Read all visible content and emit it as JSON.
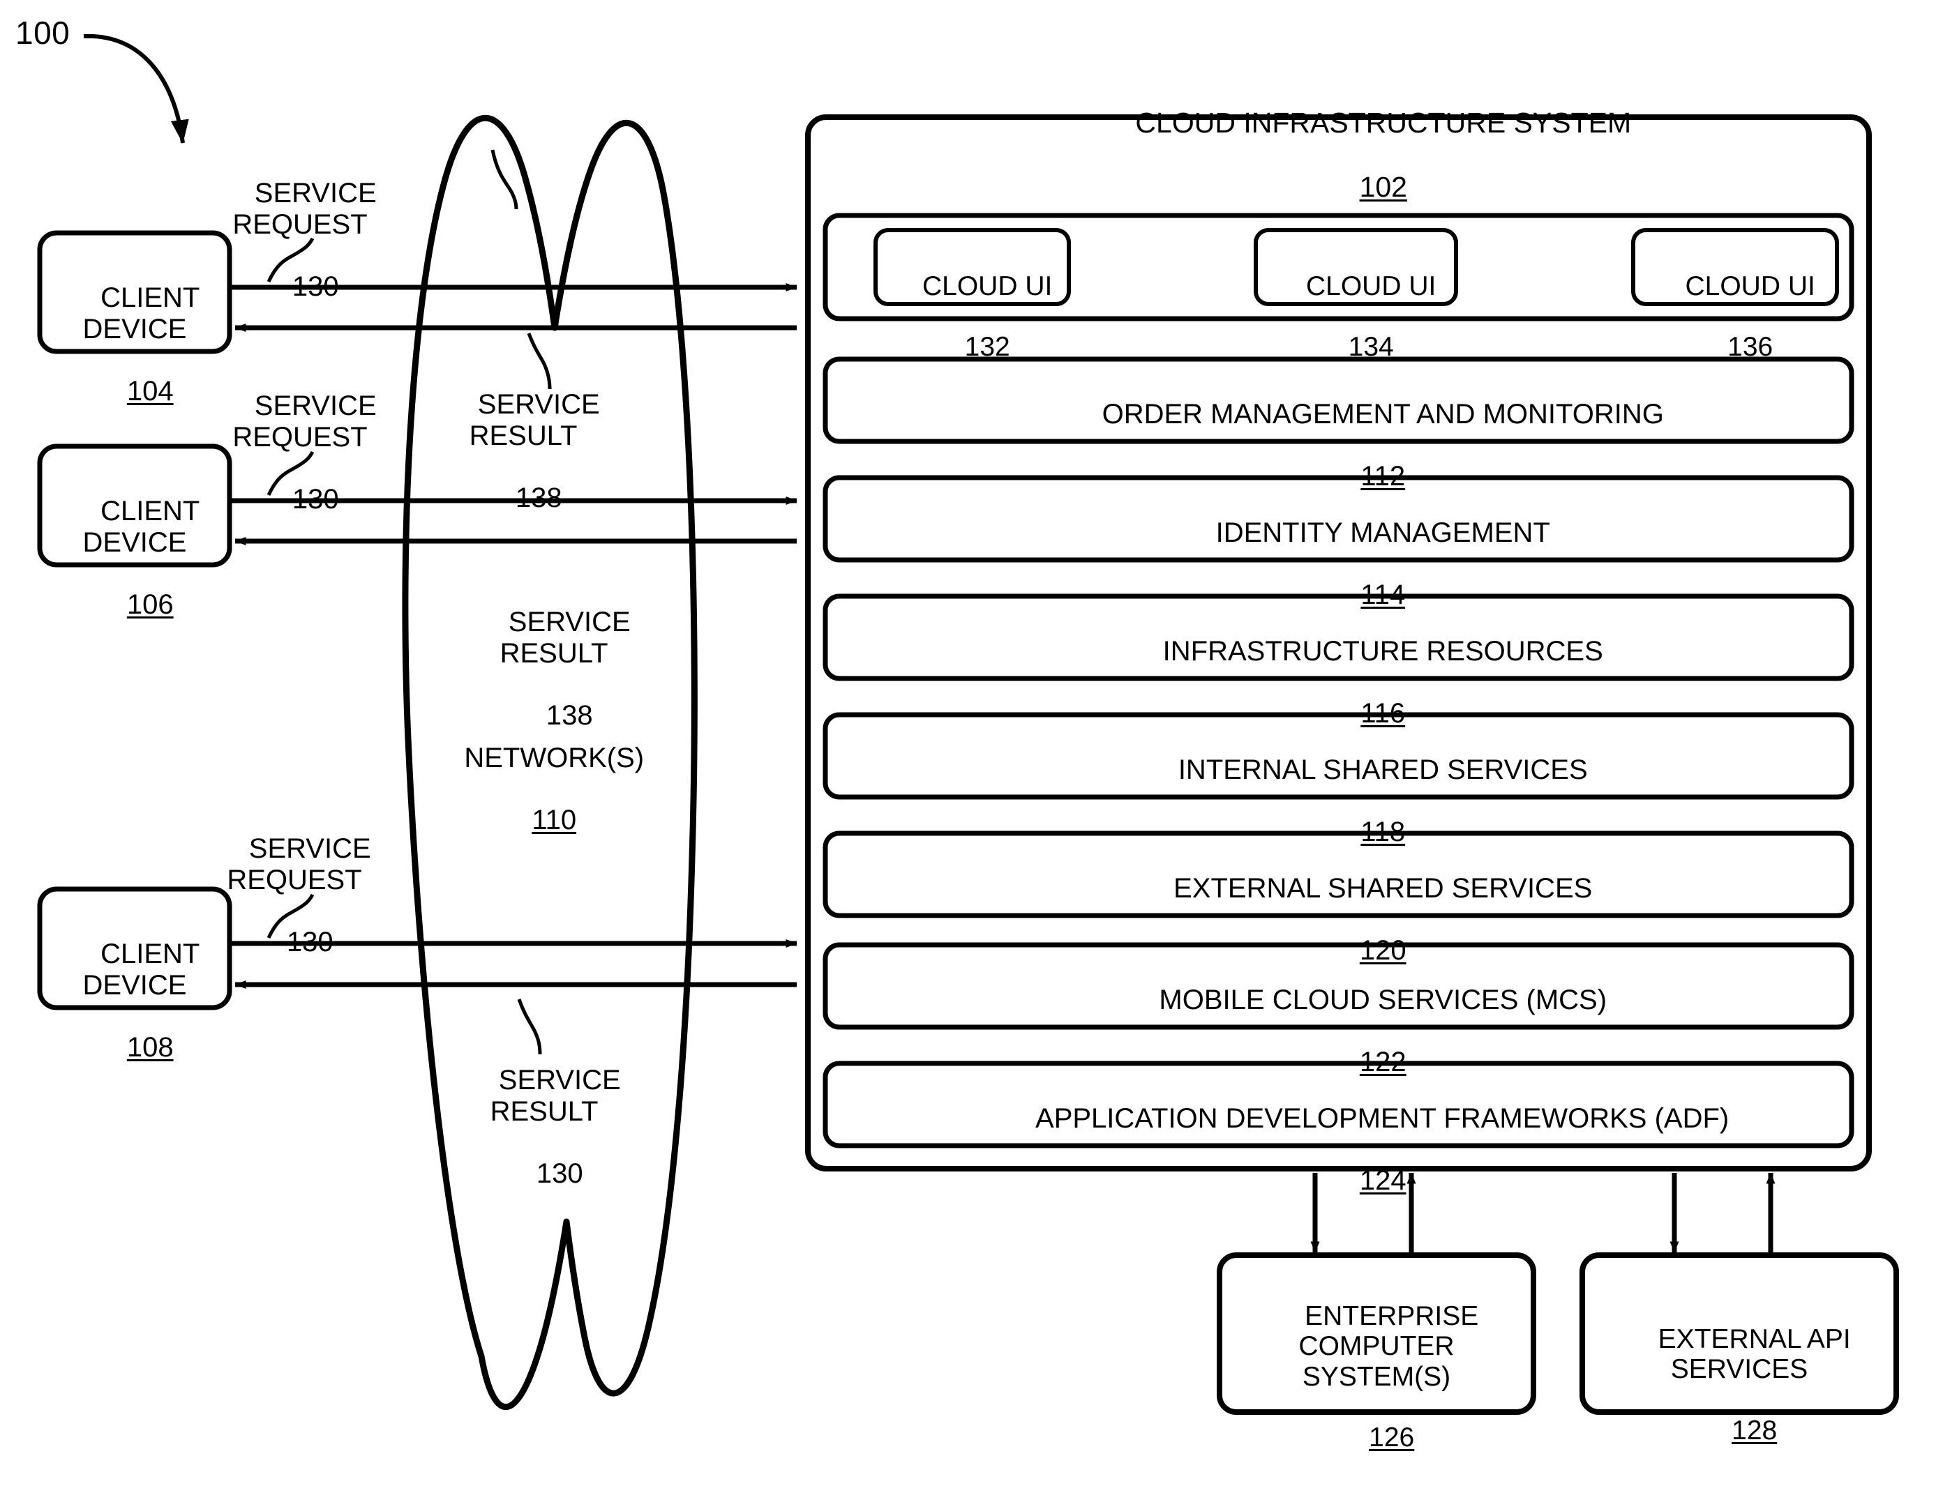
{
  "figure": {
    "reference_numeral": "100"
  },
  "clients": [
    {
      "name": "CLIENT\nDEVICE",
      "ref": "104"
    },
    {
      "name": "CLIENT\nDEVICE",
      "ref": "106"
    },
    {
      "name": "CLIENT\nDEVICE",
      "ref": "108"
    }
  ],
  "flows": {
    "request_1": {
      "text": "SERVICE\nREQUEST",
      "ref": "130"
    },
    "request_2": {
      "text": "SERVICE\nREQUEST",
      "ref": "130"
    },
    "request_3": {
      "text": "SERVICE\nREQUEST",
      "ref": "130"
    },
    "result_1": {
      "text": "SERVICE\nRESULT",
      "ref": "138"
    },
    "result_2": {
      "text": "SERVICE\nRESULT",
      "ref": "138"
    },
    "result_3": {
      "text": "SERVICE\nRESULT",
      "ref": "130"
    }
  },
  "network": {
    "label": "NETWORK(S)",
    "ref": "110"
  },
  "cloud_system": {
    "title": "CLOUD INFRASTRUCTURE SYSTEM",
    "ref": "102",
    "ui_row": [
      {
        "label": "CLOUD UI",
        "ref": "132"
      },
      {
        "label": "CLOUD UI",
        "ref": "134"
      },
      {
        "label": "CLOUD UI",
        "ref": "136"
      }
    ],
    "layers": [
      {
        "label": "ORDER MANAGEMENT AND MONITORING",
        "ref": "112"
      },
      {
        "label": "IDENTITY MANAGEMENT",
        "ref": "114"
      },
      {
        "label": "INFRASTRUCTURE RESOURCES",
        "ref": "116"
      },
      {
        "label": "INTERNAL SHARED SERVICES",
        "ref": "118"
      },
      {
        "label": "EXTERNAL SHARED SERVICES",
        "ref": "120"
      },
      {
        "label": "MOBILE CLOUD SERVICES (MCS)",
        "ref": "122"
      },
      {
        "label": "APPLICATION DEVELOPMENT FRAMEWORKS (ADF)",
        "ref": "124"
      }
    ]
  },
  "external_blocks": [
    {
      "label": "ENTERPRISE\nCOMPUTER\nSYSTEM(S)",
      "ref": "126"
    },
    {
      "label": "EXTERNAL API\nSERVICES",
      "ref": "128"
    }
  ],
  "colors": {
    "line": "#000000",
    "background": "#ffffff"
  }
}
